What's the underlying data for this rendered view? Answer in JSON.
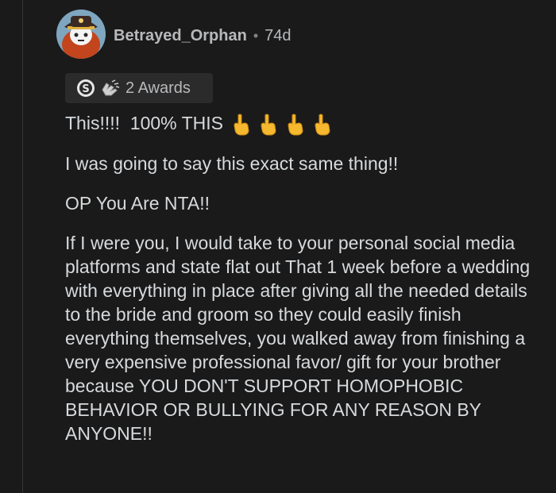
{
  "comment": {
    "username": "Betrayed_Orphan",
    "separator": "•",
    "age": "74d",
    "awards": {
      "label": "2 Awards",
      "icons": [
        "silver-award-icon",
        "helpful-award-icon"
      ]
    },
    "paragraphs": [
      "This!!!!  100% THIS",
      "I was going to say this exact same thing!!",
      "OP You Are NTA!!",
      "If I were you, I would take to your personal social media platforms and state flat out That 1 week before a wedding with everything in place after giving all the needed details to the bride and groom so they could easily finish everything themselves, you walked away from finishing a very expensive professional favor/ gift for your brother because YOU DON'T SUPPORT HOMOPHOBIC BEHAVIOR OR BULLYING FOR ANY REASON BY ANYONE!!"
    ],
    "emojis": [
      "pointing-up-icon",
      "pointing-up-icon",
      "pointing-up-icon",
      "pointing-up-icon"
    ]
  },
  "colors": {
    "background": "#1a1a1b",
    "text": "#d7dadc",
    "meta_text": "#b7b9bb",
    "award_bg": "#2b2b2c",
    "emoji": "#f5b82e"
  }
}
